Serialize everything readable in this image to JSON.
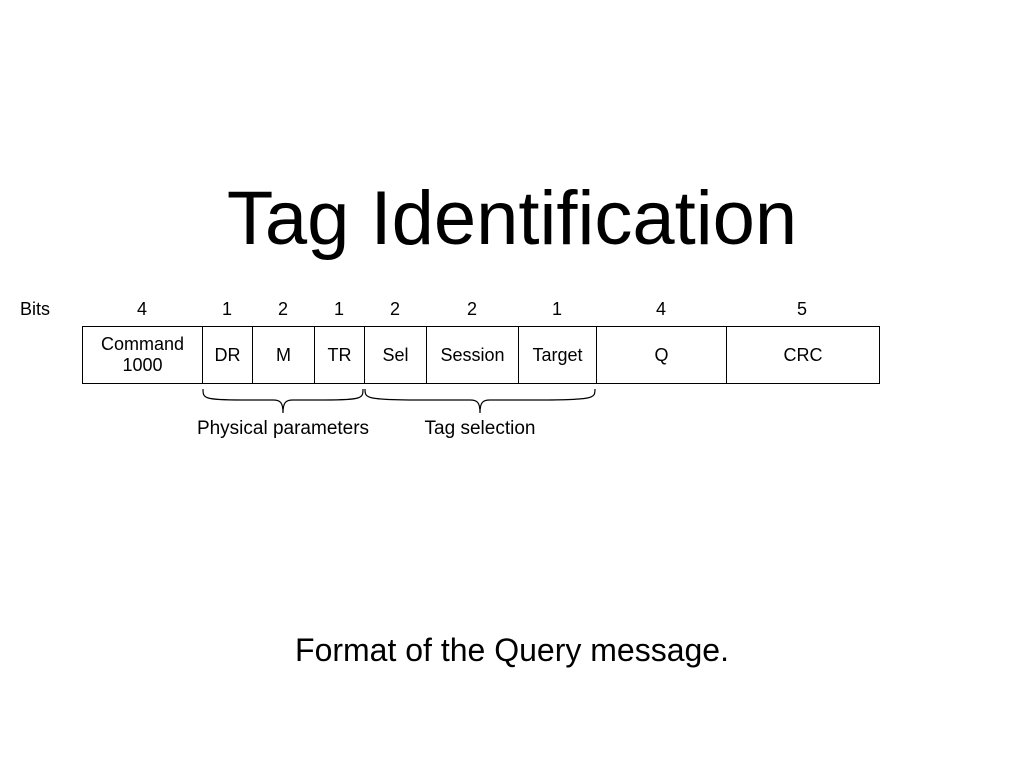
{
  "title": "Tag Identification",
  "caption": "Format of the Query message.",
  "bits_label": "Bits",
  "fields": [
    {
      "name": "Command\n1000",
      "bits": "4"
    },
    {
      "name": "DR",
      "bits": "1"
    },
    {
      "name": "M",
      "bits": "2"
    },
    {
      "name": "TR",
      "bits": "1"
    },
    {
      "name": "Sel",
      "bits": "2"
    },
    {
      "name": "Session",
      "bits": "2"
    },
    {
      "name": "Target",
      "bits": "1"
    },
    {
      "name": "Q",
      "bits": "4"
    },
    {
      "name": "CRC",
      "bits": "5"
    }
  ],
  "groups": [
    {
      "label": "Physical parameters",
      "covers": "DR,M,TR"
    },
    {
      "label": "Tag selection",
      "covers": "Sel,Session,Target"
    }
  ]
}
